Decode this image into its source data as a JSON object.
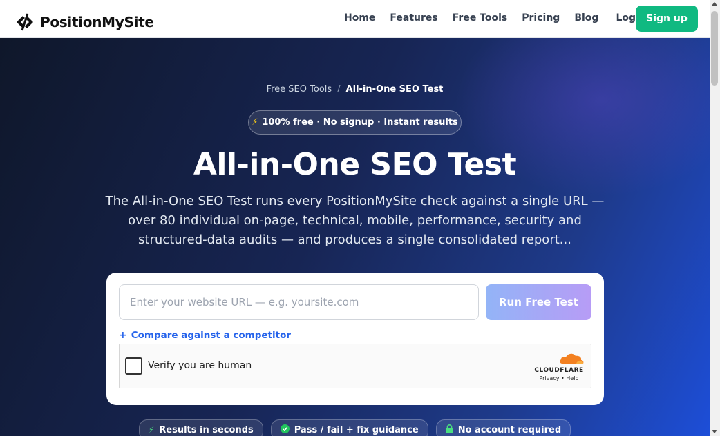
{
  "brand": {
    "name": "PositionMySite"
  },
  "nav": {
    "items": [
      "Home",
      "Features",
      "Free Tools",
      "Pricing",
      "Blog"
    ],
    "login": "Log in",
    "signup": "Sign up"
  },
  "breadcrumb": {
    "parent": "Free SEO Tools",
    "separator": "/",
    "current": "All-in-One SEO Test"
  },
  "pill": "100% free · No signup · Instant results",
  "title": "All-in-One SEO Test",
  "subtitle": "The All-in-One SEO Test runs every PositionMySite check against a single URL — over 80 individual on-page, technical, mobile, performance, security and structured-data audits — and produces a single consolidated report...",
  "form": {
    "url_placeholder": "Enter your website URL — e.g. yoursite.com",
    "url_value": "",
    "run_button": "Run Free Test",
    "compare_link": "Compare against a competitor"
  },
  "captcha": {
    "label": "Verify you are human",
    "provider": "CLOUDFLARE",
    "privacy": "Privacy",
    "help": "Help"
  },
  "badges": [
    {
      "icon": "bolt-icon",
      "label": "Results in seconds"
    },
    {
      "icon": "check-circle-icon",
      "label": "Pass / fail + fix guidance"
    },
    {
      "icon": "lock-icon",
      "label": "No account required"
    }
  ],
  "colors": {
    "accent_green": "#10b981",
    "link_blue": "#2563eb",
    "hero_dark": "#0f172a",
    "hero_blue": "#1d4ed8"
  }
}
